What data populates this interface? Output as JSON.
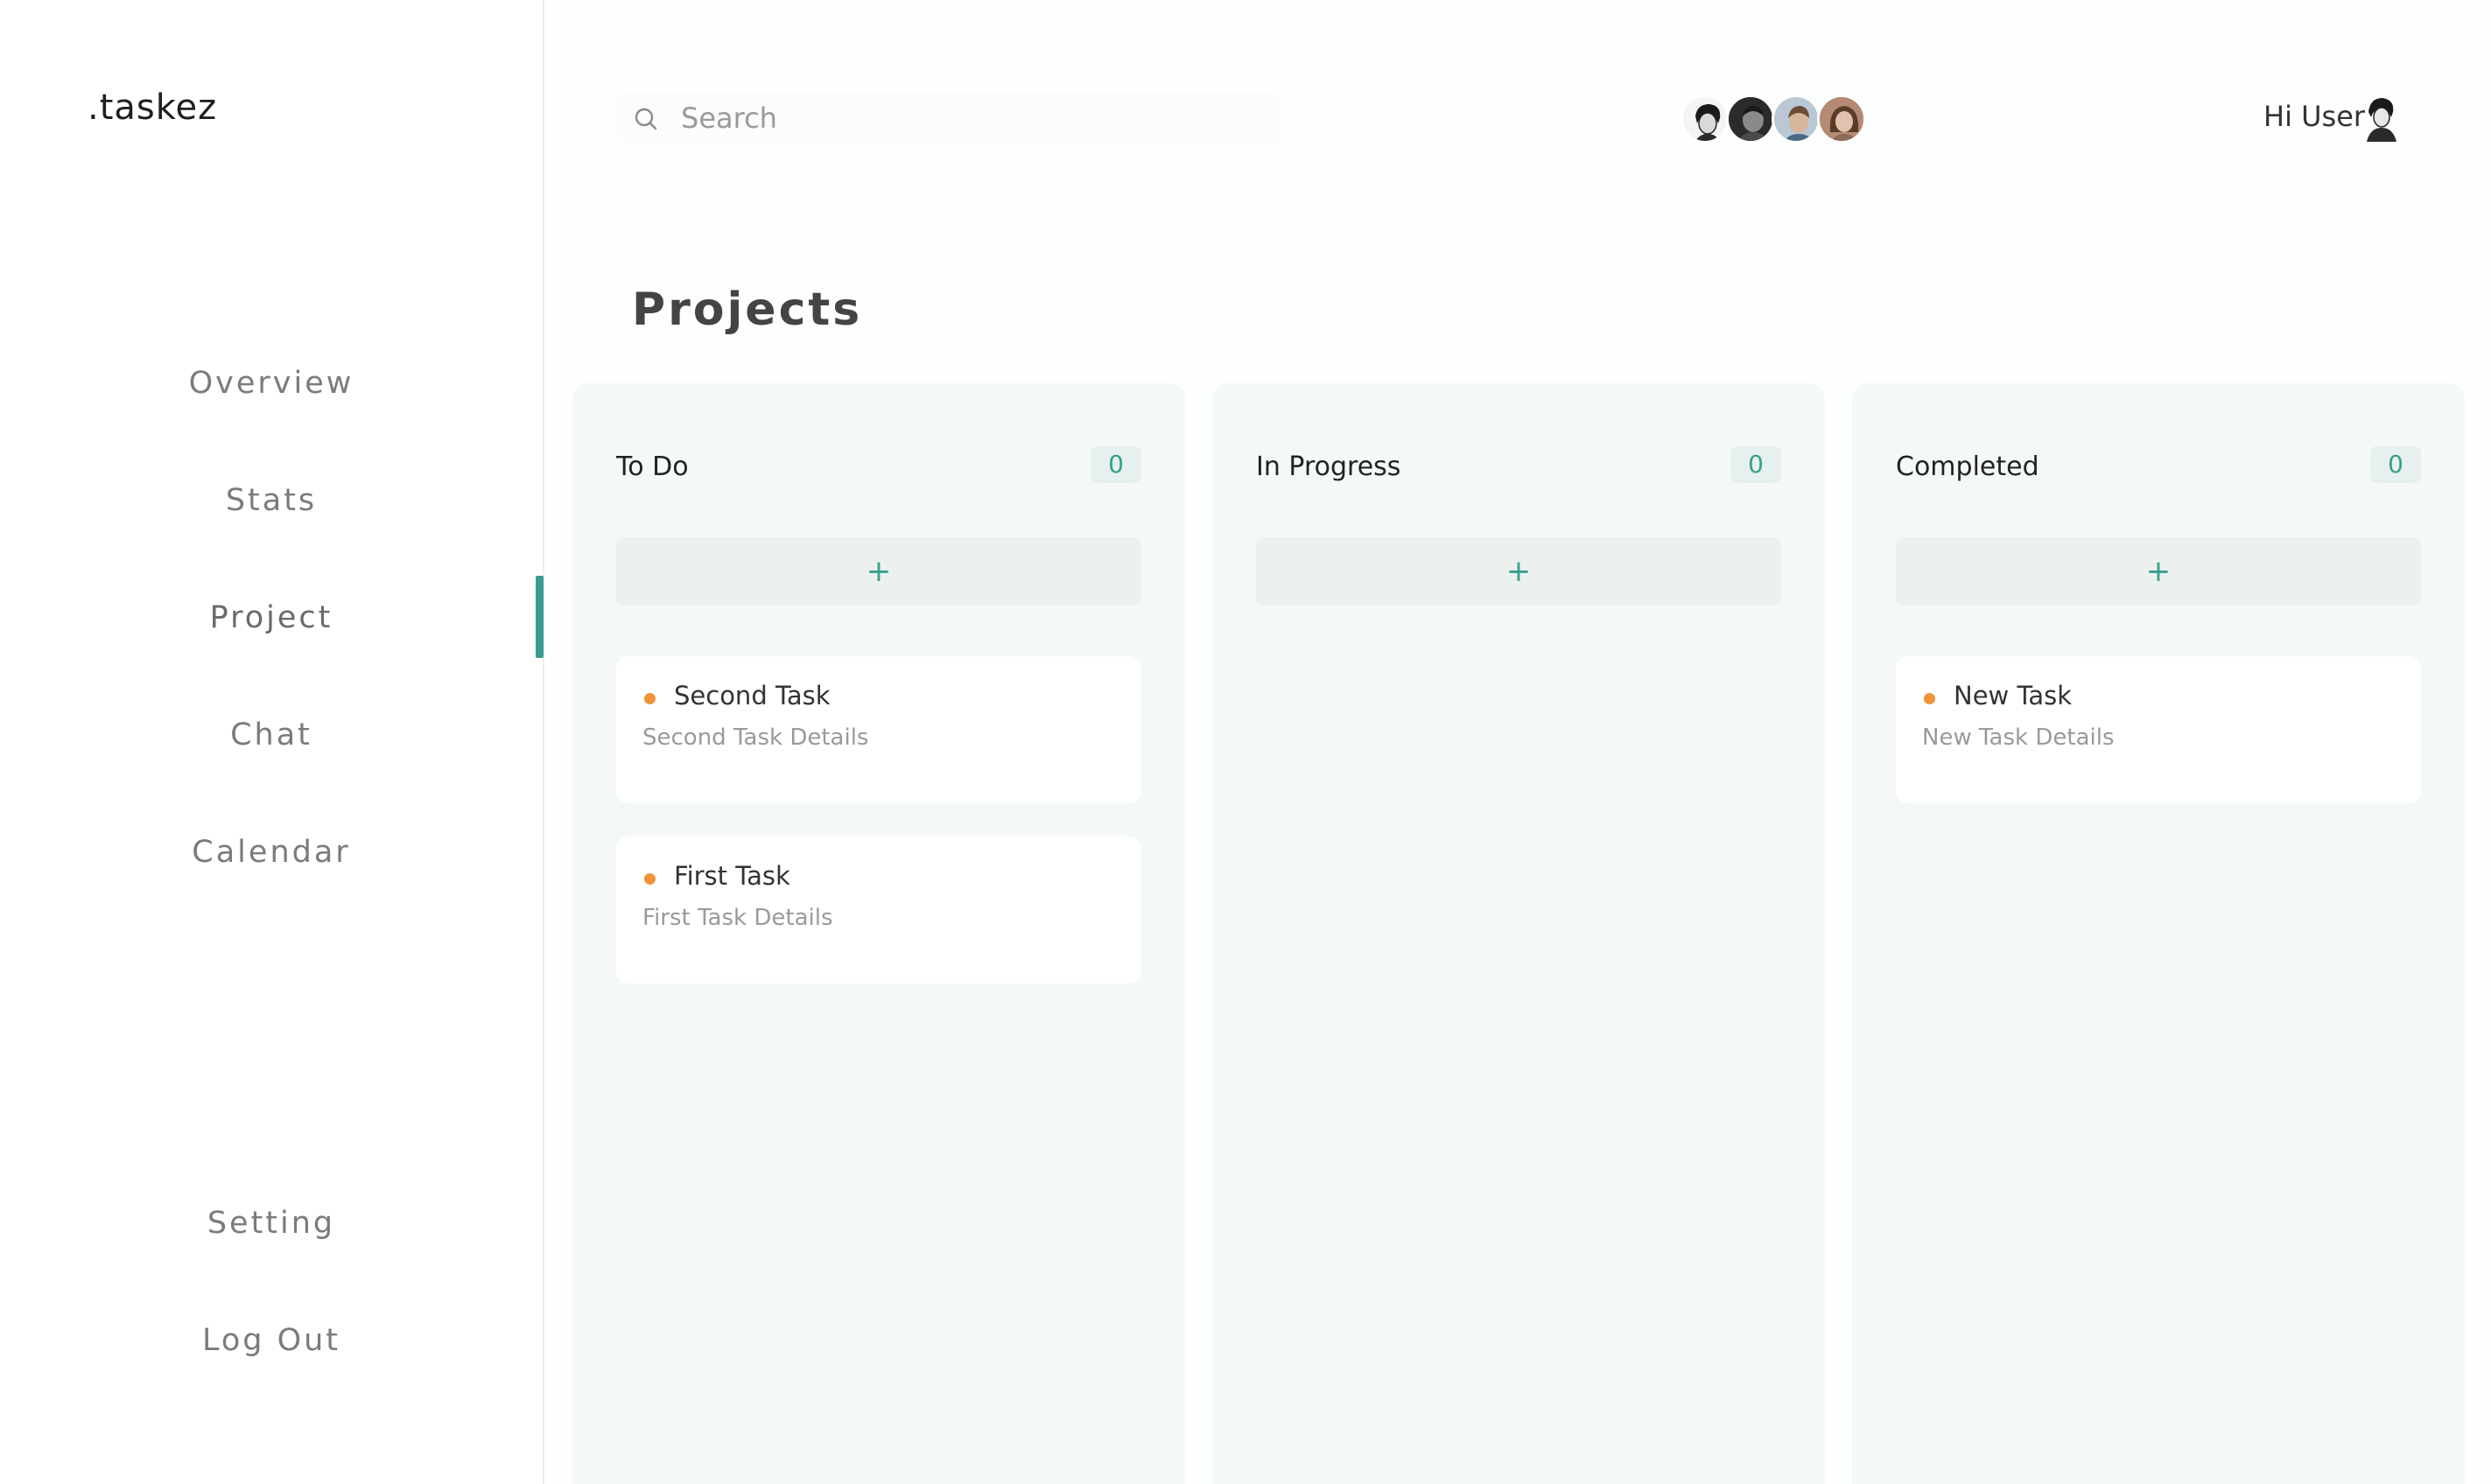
{
  "app": {
    "logo": ".taskez"
  },
  "sidebar": {
    "items": [
      {
        "label": "Overview"
      },
      {
        "label": "Stats"
      },
      {
        "label": "Project"
      },
      {
        "label": "Chat"
      },
      {
        "label": "Calendar"
      }
    ],
    "bottom_items": [
      {
        "label": "Setting"
      },
      {
        "label": "Log Out"
      }
    ],
    "active_item": "Project"
  },
  "header": {
    "search": {
      "placeholder": "Search",
      "value": ""
    },
    "greeting": "Hi User",
    "avatars": [
      "team-avatar-1",
      "team-avatar-2",
      "team-avatar-3",
      "team-avatar-4"
    ]
  },
  "main": {
    "title": "Projects",
    "columns": [
      {
        "title": "To Do",
        "count": "0",
        "add_label": "+",
        "tasks": [
          {
            "title": "Second Task",
            "details": "Second Task Details"
          },
          {
            "title": "First Task",
            "details": "First Task Details"
          }
        ]
      },
      {
        "title": "In Progress",
        "count": "0",
        "add_label": "+",
        "tasks": []
      },
      {
        "title": "Completed",
        "count": "0",
        "add_label": "+",
        "tasks": [
          {
            "title": "New Task",
            "details": "New Task Details"
          }
        ]
      }
    ]
  },
  "colors": {
    "accent": "#3a9e8e",
    "priority_dot": "#f0923a",
    "column_bg": "#f5f8f8",
    "count_bg": "#e6f1ef"
  }
}
